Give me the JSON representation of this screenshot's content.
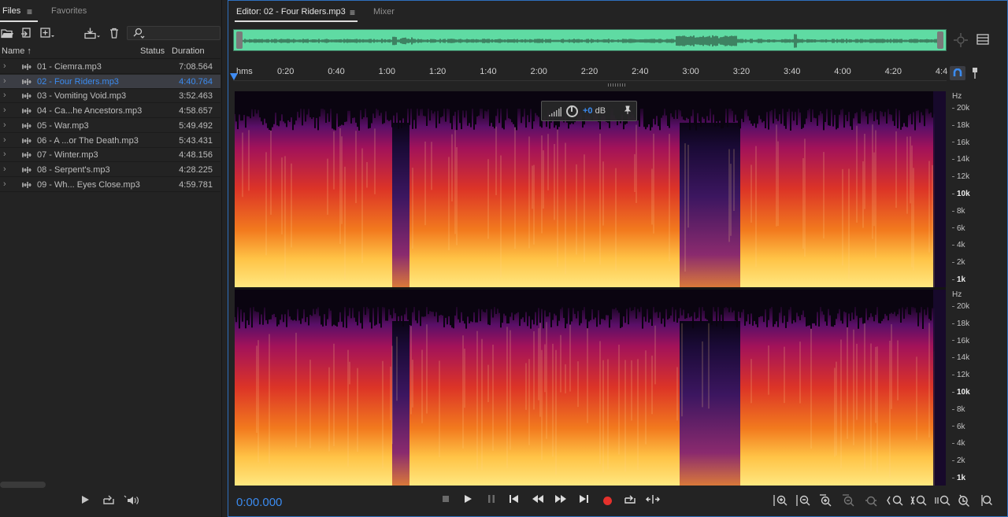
{
  "files_panel": {
    "tabs": [
      {
        "label": "Files"
      },
      {
        "label": "Favorites"
      }
    ],
    "menu_glyph": "≡",
    "columns": {
      "name": "Name",
      "status": "Status",
      "duration": "Duration"
    },
    "sort_glyph": "↑",
    "search": {
      "placeholder": ""
    },
    "files": [
      {
        "name": "01 - Ciemra.mp3",
        "duration": "7:08.564",
        "selected": false
      },
      {
        "name": "02 - Four Riders.mp3",
        "duration": "4:40.764",
        "selected": true
      },
      {
        "name": "03 - Vomiting Void.mp3",
        "duration": "3:52.463",
        "selected": false
      },
      {
        "name": "04 - Ca...he Ancestors.mp3",
        "duration": "4:58.657",
        "selected": false
      },
      {
        "name": "05 - War.mp3",
        "duration": "5:49.492",
        "selected": false
      },
      {
        "name": "06 - A ...or The Death.mp3",
        "duration": "5:43.431",
        "selected": false
      },
      {
        "name": "07 - Winter.mp3",
        "duration": "4:48.156",
        "selected": false
      },
      {
        "name": "08 - Serpent's.mp3",
        "duration": "4:28.225",
        "selected": false
      },
      {
        "name": "09 - Wh... Eyes Close.mp3",
        "duration": "4:59.781",
        "selected": false
      }
    ]
  },
  "editor": {
    "tabs": [
      {
        "label": "Editor: 02 - Four Riders.mp3"
      },
      {
        "label": "Mixer"
      }
    ],
    "timeline_unit": "hms",
    "ticks": [
      "0:20",
      "0:40",
      "1:00",
      "1:20",
      "1:40",
      "2:00",
      "2:20",
      "2:40",
      "3:00",
      "3:20",
      "3:40",
      "4:00",
      "4:20",
      "4:4"
    ],
    "hz_unit": "Hz",
    "hz_labels": [
      {
        "label": "20k",
        "bold": false
      },
      {
        "label": "18k",
        "bold": false
      },
      {
        "label": "16k",
        "bold": false
      },
      {
        "label": "14k",
        "bold": false
      },
      {
        "label": "12k",
        "bold": false
      },
      {
        "label": "10k",
        "bold": true
      },
      {
        "label": "8k",
        "bold": false
      },
      {
        "label": "6k",
        "bold": false
      },
      {
        "label": "4k",
        "bold": false
      },
      {
        "label": "2k",
        "bold": false
      },
      {
        "label": "1k",
        "bold": true
      }
    ],
    "hud": {
      "value": "+0",
      "unit": "dB"
    },
    "timecode": "0:00.000",
    "colors": {
      "accent": "#3b8bf0",
      "overview": "#5fdba3",
      "record": "#e5312c",
      "panel_border": "#2e6fbd"
    }
  }
}
